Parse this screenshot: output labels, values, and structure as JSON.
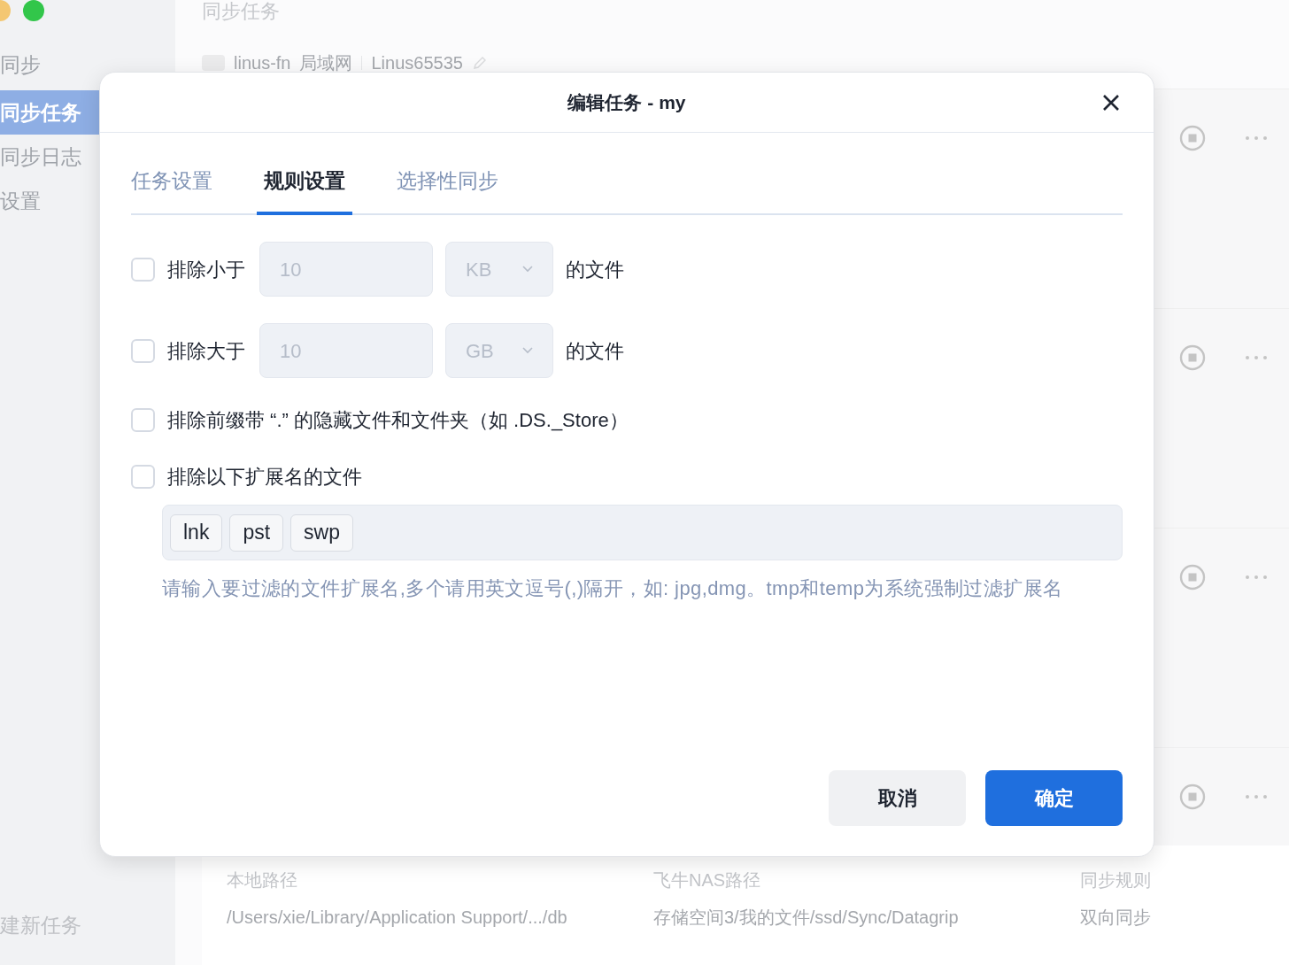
{
  "sidebar": {
    "section": "同步",
    "items": [
      {
        "label": "同步任务",
        "selected": true
      },
      {
        "label": "同步日志",
        "selected": false
      },
      {
        "label": "设置",
        "selected": false
      }
    ],
    "new_task": "建新任务"
  },
  "page": {
    "title": "同步任务",
    "device": {
      "name": "linus-fn",
      "network": "局域网",
      "user": "Linus65535"
    }
  },
  "tasks": [
    {
      "running": true
    },
    {
      "running": true
    },
    {
      "running": true
    },
    {
      "running": true,
      "details": [
        {
          "label": "本地路径",
          "value": "/Users/xie/Library/Application Support/.../db"
        },
        {
          "label": "飞牛NAS路径",
          "value": "存储空间3/我的文件/ssd/Sync/Datagrip"
        },
        {
          "label": "同步规则",
          "value": "双向同步"
        }
      ]
    }
  ],
  "dialog": {
    "title": "编辑任务 - my",
    "tabs": [
      {
        "label": "任务设置",
        "selected": false
      },
      {
        "label": "规则设置",
        "selected": true
      },
      {
        "label": "选择性同步",
        "selected": false
      }
    ],
    "rules": [
      {
        "kind": "size",
        "checked": false,
        "label": "排除小于",
        "value": "10",
        "unit": "KB",
        "suffix": "的文件"
      },
      {
        "kind": "size",
        "checked": false,
        "label": "排除大于",
        "value": "10",
        "unit": "GB",
        "suffix": "的文件"
      },
      {
        "kind": "plain",
        "checked": false,
        "label": "排除前缀带 “.” 的隐藏文件和文件夹（如 .DS._Store）"
      },
      {
        "kind": "extensions",
        "checked": false,
        "label": "排除以下扩展名的文件",
        "tags": [
          "lnk",
          "pst",
          "swp"
        ],
        "hint": "请输入要过滤的文件扩展名,多个请用英文逗号(,)隔开，如: jpg,dmg。tmp和temp为系统强制过滤扩展名"
      }
    ],
    "buttons": [
      {
        "label": "取消",
        "kind": "secondary"
      },
      {
        "label": "确定",
        "kind": "primary"
      }
    ]
  }
}
